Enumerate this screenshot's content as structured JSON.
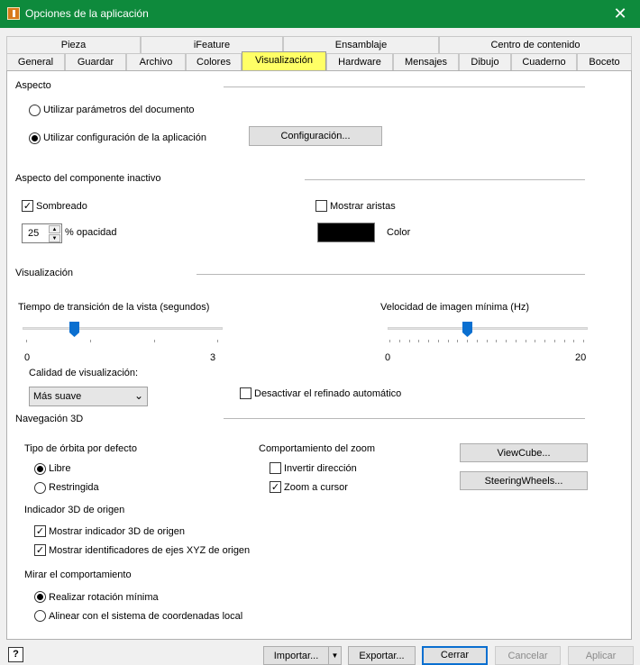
{
  "window": {
    "title": "Opciones de la aplicación"
  },
  "tabs_top": [
    "Pieza",
    "iFeature",
    "Ensamblaje",
    "Centro de contenido"
  ],
  "tabs_bottom": [
    "General",
    "Guardar",
    "Archivo",
    "Colores",
    "Visualización",
    "Hardware",
    "Mensajes",
    "Dibujo",
    "Cuaderno",
    "Boceto"
  ],
  "aspecto": {
    "heading": "Aspecto",
    "option_document": "Utilizar parámetros del documento",
    "option_app": "Utilizar configuración de la aplicación",
    "config_button": "Configuración...",
    "selected": "option_app"
  },
  "inactive": {
    "heading": "Aspecto del componente inactivo",
    "shaded_label": "Sombreado",
    "shaded_checked": true,
    "show_edges_label": "Mostrar aristas",
    "show_edges_checked": false,
    "opacity_value": "25",
    "opacity_label": "% opacidad",
    "color_label": "Color",
    "color": "#000000"
  },
  "visual": {
    "heading": "Visualización",
    "transition_label": "Tiempo de transición de la vista (segundos)",
    "transition_min": "0",
    "transition_max": "3",
    "transition_value": 0.75,
    "framerate_label": "Velocidad de imagen mínima (Hz)",
    "framerate_min": "0",
    "framerate_max": "20",
    "framerate_value": 8,
    "quality_label": "Calidad de visualización:",
    "quality_value": "Más suave",
    "disable_refine_label": "Desactivar el refinado automático",
    "disable_refine_checked": false
  },
  "nav3d": {
    "heading": "Navegación 3D",
    "orbit_heading": "Tipo de órbita por defecto",
    "orbit_free": "Libre",
    "orbit_constrained": "Restringida",
    "orbit_selected": "free",
    "zoom_heading": "Comportamiento del zoom",
    "zoom_invert": "Invertir dirección",
    "zoom_invert_checked": false,
    "zoom_cursor": "Zoom a cursor",
    "zoom_cursor_checked": true,
    "viewcube_button": "ViewCube...",
    "steering_button": "SteeringWheels...",
    "origin_heading": "Indicador 3D de origen",
    "origin_show": "Mostrar indicador 3D de origen",
    "origin_show_checked": true,
    "origin_axes": "Mostrar identificadores de ejes XYZ de origen",
    "origin_axes_checked": true,
    "look_heading": "Mirar el comportamiento",
    "look_min_rotation": "Realizar rotación mínima",
    "look_align": "Alinear con el sistema de coordenadas local",
    "look_selected": "min_rotation"
  },
  "footer": {
    "help": "?",
    "import": "Importar...",
    "export": "Exportar...",
    "close": "Cerrar",
    "cancel": "Cancelar",
    "apply": "Aplicar"
  },
  "colors": {
    "titlebar": "#0e8a3c",
    "active_tab": "#ffff66",
    "slider_thumb": "#0a6fd0",
    "default_button_border": "#0a6fd0"
  }
}
